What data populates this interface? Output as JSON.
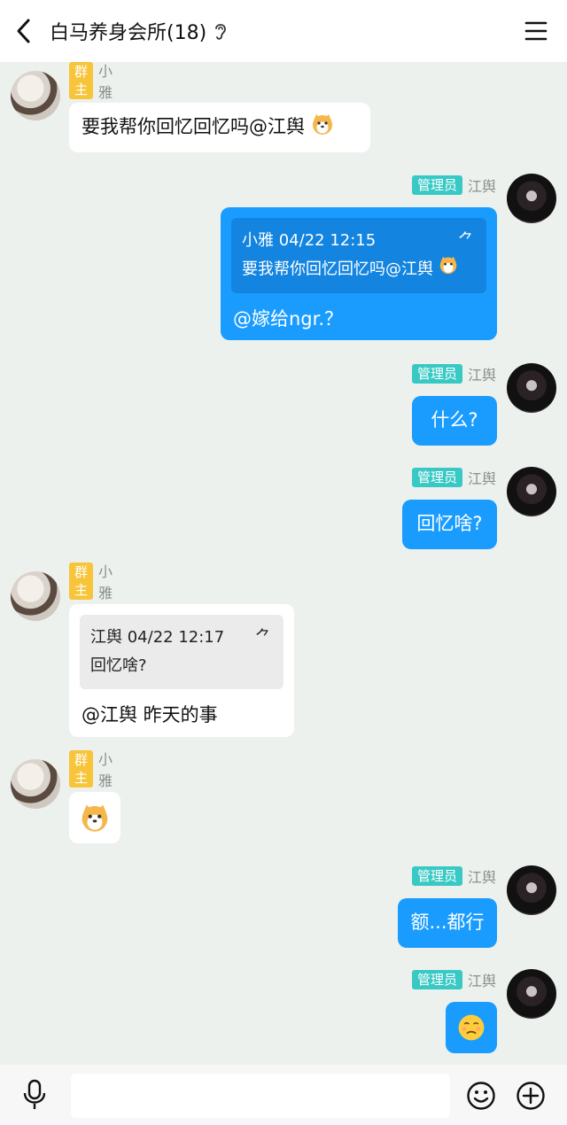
{
  "header": {
    "title": "白马养身会所(18)"
  },
  "messages": [
    {
      "side": "left",
      "badge": "群主",
      "sender": "小雅",
      "text": "要我帮你回忆回忆吗@江舆"
    },
    {
      "side": "right",
      "badge": "管理员",
      "sender": "江舆",
      "quote_meta": "小雅 04/22 12:15",
      "quote_text": "要我帮你回忆回忆吗@江舆",
      "text": "@嫁给ngr.？"
    },
    {
      "side": "right",
      "badge": "管理员",
      "sender": "江舆",
      "text": "什么?"
    },
    {
      "side": "right",
      "badge": "管理员",
      "sender": "江舆",
      "text": "回忆啥?"
    },
    {
      "side": "left",
      "badge": "群主",
      "sender": "小雅",
      "quote_meta": "江舆 04/22 12:17",
      "quote_text": "回忆啥?",
      "text": "@江舆 昨天的事"
    },
    {
      "side": "left",
      "badge": "群主",
      "sender": "小雅",
      "emoji": "shiba-dog-emoji"
    },
    {
      "side": "right",
      "badge": "管理员",
      "sender": "江舆",
      "text": "额...都行"
    },
    {
      "side": "right",
      "badge": "管理员",
      "sender": "江舆",
      "emoji": "pleading-face-emoji"
    }
  ],
  "quote_arrow": "⺈",
  "input": {
    "placeholder": ""
  },
  "icons": [
    "back-icon",
    "ear-icon",
    "menu-icon",
    "mic-icon",
    "emoji-icon",
    "plus-icon"
  ],
  "colors": {
    "accent": "#1a9cff",
    "owner_badge": "#f7c43a",
    "admin_badge": "#39c9c5",
    "background": "#edf1ee"
  }
}
